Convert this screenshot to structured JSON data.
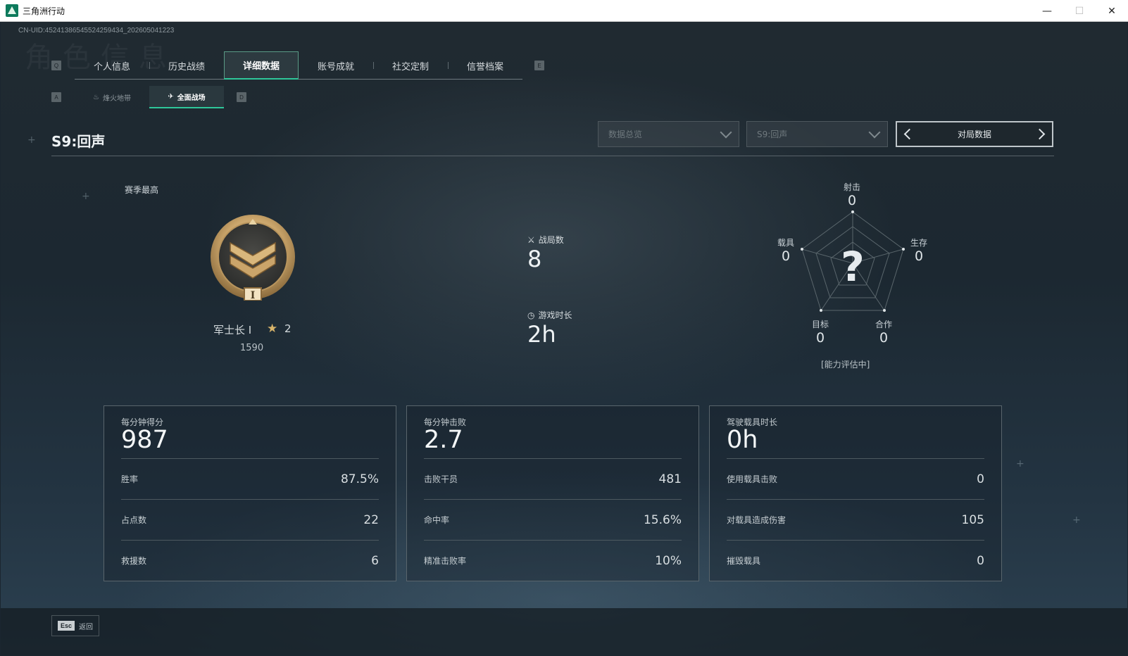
{
  "window": {
    "title": "三角洲行动",
    "minimize": "—",
    "maximize": "☐",
    "close": "✕"
  },
  "uid": "CN-UID:45241386545524259434_202605041223",
  "tabs": {
    "prev_key": "Q",
    "next_key": "E",
    "items": [
      "个人信息",
      "历史战绩",
      "详细数据",
      "账号成就",
      "社交定制",
      "信誉档案"
    ],
    "active": "详细数据"
  },
  "subtabs": {
    "prev_key": "A",
    "next_key": "D",
    "items": [
      {
        "label": "烽火地带",
        "icon": "flame-icon"
      },
      {
        "label": "全面战场",
        "icon": "battlefield-icon"
      }
    ],
    "active": "全面战场"
  },
  "season": {
    "title": "S9:回声",
    "filter_category": "数据总览",
    "filter_season": "S9:回声",
    "pager_label": "对局数据"
  },
  "rank": {
    "heading": "赛季最高",
    "name": "军士长 I",
    "stars": "2",
    "score": "1590",
    "medal_numeral": "I"
  },
  "summary": {
    "matches_label": "战局数",
    "matches_value": "8",
    "playtime_label": "游戏时长",
    "playtime_value": "2h"
  },
  "radar": {
    "axes": [
      {
        "label": "射击",
        "value": "0"
      },
      {
        "label": "生存",
        "value": "0"
      },
      {
        "label": "合作",
        "value": "0"
      },
      {
        "label": "目标",
        "value": "0"
      },
      {
        "label": "载具",
        "value": "0"
      }
    ],
    "placeholder": "?",
    "status": "[能力评估中]"
  },
  "cards": [
    {
      "title": "每分钟得分",
      "value": "987",
      "rows": [
        {
          "label": "胜率",
          "value": "87.5%"
        },
        {
          "label": "占点数",
          "value": "22"
        },
        {
          "label": "救援数",
          "value": "6"
        }
      ]
    },
    {
      "title": "每分钟击败",
      "value": "2.7",
      "rows": [
        {
          "label": "击败干员",
          "value": "481"
        },
        {
          "label": "命中率",
          "value": "15.6%"
        },
        {
          "label": "精准击败率",
          "value": "10%"
        }
      ]
    },
    {
      "title": "驾驶载具时长",
      "value": "0h",
      "rows": [
        {
          "label": "使用载具击败",
          "value": "0"
        },
        {
          "label": "对载具造成伤害",
          "value": "105"
        },
        {
          "label": "摧毁载具",
          "value": "0"
        }
      ]
    }
  ],
  "footer": {
    "key": "Esc",
    "label": "返回"
  },
  "colors": {
    "accent": "#2ec79a",
    "medal_gold": "#c9a46a"
  }
}
